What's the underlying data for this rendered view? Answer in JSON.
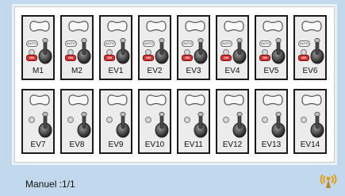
{
  "switches": [
    {
      "label": "M1",
      "auto": true,
      "on": true
    },
    {
      "label": "M2",
      "auto": true,
      "on": true
    },
    {
      "label": "EV1",
      "auto": true,
      "on": true
    },
    {
      "label": "EV2",
      "auto": true,
      "on": true
    },
    {
      "label": "EV3",
      "auto": true,
      "on": true
    },
    {
      "label": "EV4",
      "auto": true,
      "on": true
    },
    {
      "label": "EV5",
      "auto": true,
      "on": true
    },
    {
      "label": "EV6",
      "auto": true,
      "on": true
    },
    {
      "label": "EV7",
      "auto": false,
      "on": false
    },
    {
      "label": "EV8",
      "auto": false,
      "on": false
    },
    {
      "label": "EV9",
      "auto": false,
      "on": false
    },
    {
      "label": "EV10",
      "auto": false,
      "on": false
    },
    {
      "label": "EV11",
      "auto": false,
      "on": false
    },
    {
      "label": "EV12",
      "auto": false,
      "on": false
    },
    {
      "label": "EV13",
      "auto": false,
      "on": false
    },
    {
      "label": "EV14",
      "auto": false,
      "on": false
    }
  ],
  "indicator_text": {
    "auto": "AUTO",
    "on": "ON"
  },
  "status": {
    "text": "Manuel :1/1"
  },
  "colors": {
    "background": "#c2d8ec",
    "card": "#ececec",
    "on_button": "#d43333",
    "signal": "#e0a020"
  },
  "icons": {
    "signal": "wifi-signal-icon"
  }
}
